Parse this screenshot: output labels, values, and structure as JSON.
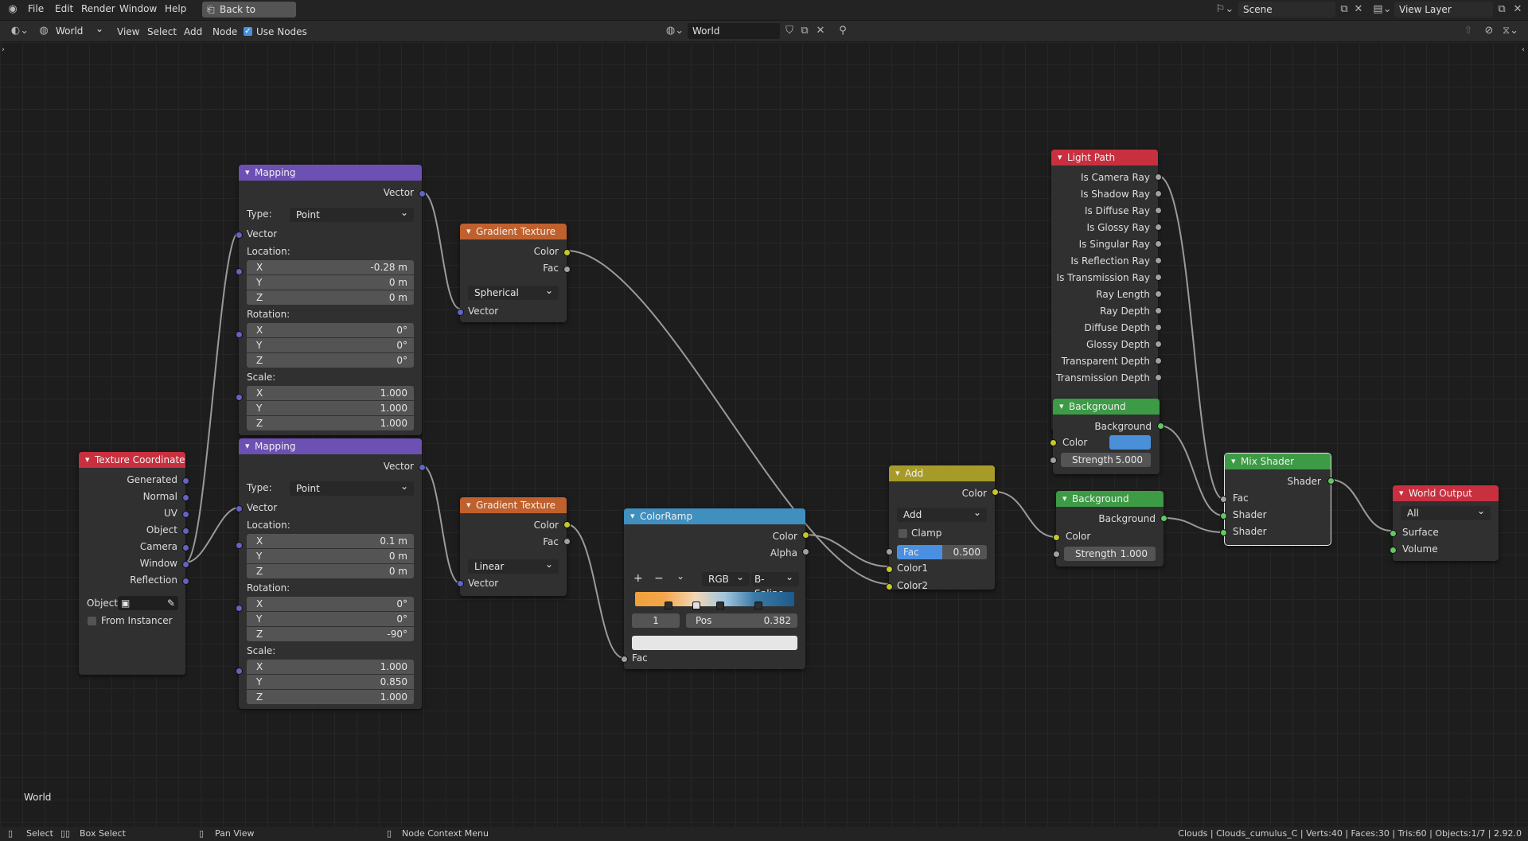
{
  "topbar": {
    "menus": [
      "File",
      "Edit",
      "Render",
      "Window",
      "Help"
    ],
    "back_button": "Back to Previous",
    "scene_field": "Scene",
    "view_layer_field": "View Layer"
  },
  "header": {
    "shader_type": "World",
    "menus": [
      "View",
      "Select",
      "Add",
      "Node"
    ],
    "use_nodes_label": "Use Nodes",
    "use_nodes_checked": true,
    "world_field": "World"
  },
  "editor": {
    "label": "World"
  },
  "nodes": {
    "texcoord": {
      "title": "Texture Coordinate",
      "outputs": [
        "Generated",
        "Normal",
        "UV",
        "Object",
        "Camera",
        "Window",
        "Reflection"
      ],
      "object_label": "Object:",
      "from_instancer": "From Instancer",
      "color": "#c8303f"
    },
    "mapping1": {
      "title": "Mapping",
      "output": "Vector",
      "type_label": "Type:",
      "type_value": "Point",
      "vector_label": "Vector",
      "location_label": "Location:",
      "location": [
        "-0.28 m",
        "0 m",
        "0 m"
      ],
      "rotation_label": "Rotation:",
      "rotation": [
        "0°",
        "0°",
        "0°"
      ],
      "scale_label": "Scale:",
      "scale": [
        "1.000",
        "1.000",
        "1.000"
      ],
      "axes": [
        "X",
        "Y",
        "Z"
      ],
      "color": "#6c50b4"
    },
    "mapping2": {
      "title": "Mapping",
      "output": "Vector",
      "type_label": "Type:",
      "type_value": "Point",
      "vector_label": "Vector",
      "location_label": "Location:",
      "location": [
        "0.1 m",
        "0 m",
        "0 m"
      ],
      "rotation_label": "Rotation:",
      "rotation": [
        "0°",
        "0°",
        "-90°"
      ],
      "scale_label": "Scale:",
      "scale": [
        "1.000",
        "0.850",
        "1.000"
      ],
      "axes": [
        "X",
        "Y",
        "Z"
      ],
      "color": "#6c50b4"
    },
    "gradient1": {
      "title": "Gradient Texture",
      "outputs": [
        "Color",
        "Fac"
      ],
      "mode": "Spherical",
      "input": "Vector",
      "color": "#c0602d"
    },
    "gradient2": {
      "title": "Gradient Texture",
      "outputs": [
        "Color",
        "Fac"
      ],
      "mode": "Linear",
      "input": "Vector",
      "color": "#c0602d"
    },
    "colorramp": {
      "title": "ColorRamp",
      "outputs": [
        "Color",
        "Alpha"
      ],
      "color_mode": "RGB",
      "interpolation": "B-Spline",
      "index": "1",
      "pos_label": "Pos",
      "pos_value": "0.382",
      "input": "Fac",
      "add_symbol": "+",
      "remove_symbol": "−",
      "menu_symbol": "⌄",
      "color": "#3f8fbf"
    },
    "add": {
      "title": "Add",
      "output": "Color",
      "blend": "Add",
      "clamp_label": "Clamp",
      "fac_label": "Fac",
      "fac_value": "0.500",
      "fac_fraction": 0.5,
      "inputs": [
        "Color1",
        "Color2"
      ],
      "color": "#a69b29"
    },
    "lightpath": {
      "title": "Light Path",
      "outputs": [
        "Is Camera Ray",
        "Is Shadow Ray",
        "Is Diffuse Ray",
        "Is Glossy Ray",
        "Is Singular Ray",
        "Is Reflection Ray",
        "Is Transmission Ray",
        "Ray Length",
        "Ray Depth",
        "Diffuse Depth",
        "Glossy Depth",
        "Transparent Depth",
        "Transmission Depth"
      ],
      "color": "#c8303f"
    },
    "bg1": {
      "title": "Background",
      "output": "Background",
      "color_label": "Color",
      "swatch": "#4a90d9",
      "strength_label": "Strength",
      "strength_value": "5.000",
      "color": "#3d9a45"
    },
    "bg2": {
      "title": "Background",
      "output": "Background",
      "color_label": "Color",
      "strength_label": "Strength",
      "strength_value": "1.000",
      "color": "#3d9a45"
    },
    "mix": {
      "title": "Mix Shader",
      "output": "Shader",
      "inputs": [
        "Fac",
        "Shader",
        "Shader"
      ],
      "color": "#3d9a45"
    },
    "output": {
      "title": "World Output",
      "target": "All",
      "inputs": [
        "Surface",
        "Volume"
      ],
      "color": "#c8303f"
    }
  },
  "status": {
    "select": "Select",
    "box_select": "Box Select",
    "pan_view": "Pan View",
    "context_menu": "Node Context Menu",
    "info": "Clouds | Clouds_cumulus_C | Verts:40 | Faces:30 | Tris:60 | Objects:1/7 | 2.92.0"
  }
}
